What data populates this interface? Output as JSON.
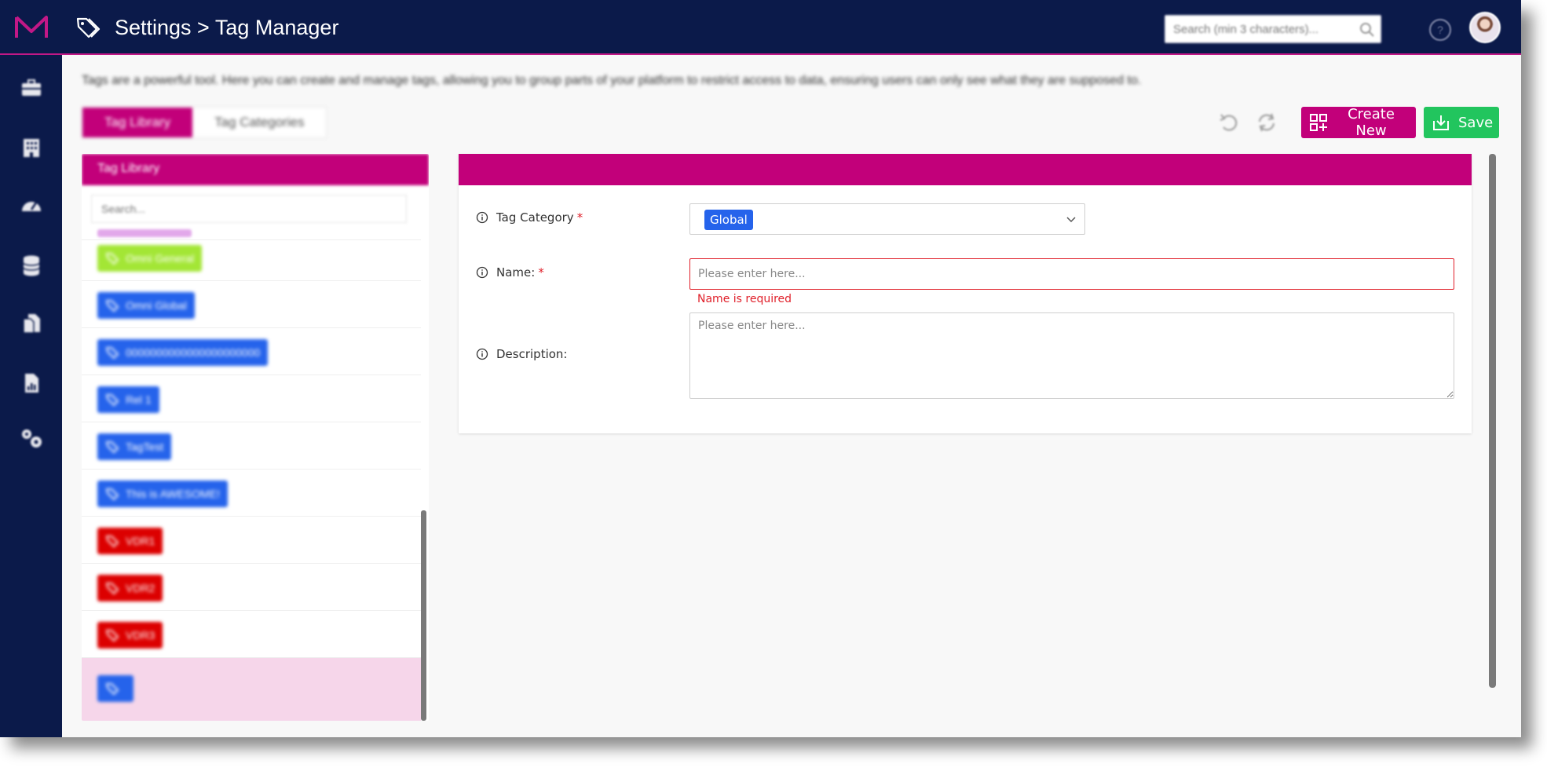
{
  "header": {
    "title": "Settings > Tag Manager",
    "search_placeholder": "Search (min 3 characters)..."
  },
  "sidebar": {
    "items": [
      {
        "icon": "briefcase-icon"
      },
      {
        "icon": "building-icon"
      },
      {
        "icon": "dashboard-gauge-icon"
      },
      {
        "icon": "database-icon"
      },
      {
        "icon": "documents-icon"
      },
      {
        "icon": "report-icon"
      },
      {
        "icon": "settings-gears-icon"
      }
    ]
  },
  "intro_text": "Tags are a powerful tool. Here you can create and manage tags, allowing you to group parts of your platform to restrict access to data, ensuring users can only see what they are supposed to.",
  "tabs": [
    {
      "label": "Tag Library",
      "active": true
    },
    {
      "label": "Tag Categories",
      "active": false
    }
  ],
  "toolbar": {
    "create_label": "Create New",
    "save_label": "Save"
  },
  "library": {
    "header": "Tag Library",
    "search_placeholder": "Search...",
    "tags": [
      {
        "label": "Omni General",
        "color": "#a3e635"
      },
      {
        "label": "Omni Global",
        "color": "#2563eb"
      },
      {
        "label": "0000000000000000000000",
        "color": "#2563eb"
      },
      {
        "label": "Rel 1",
        "color": "#2563eb"
      },
      {
        "label": "TagTest",
        "color": "#2563eb"
      },
      {
        "label": "This is AWESOME!",
        "color": "#2563eb"
      },
      {
        "label": "VDR1",
        "color": "#dc0000"
      },
      {
        "label": "VDR2",
        "color": "#dc0000"
      },
      {
        "label": "VDR3",
        "color": "#dc0000"
      },
      {
        "label": "",
        "color": "#2563eb"
      }
    ]
  },
  "form": {
    "category_label": "Tag Category",
    "category_value": "Global",
    "name_label": "Name:",
    "name_placeholder": "Please enter here...",
    "name_error": "Name is required",
    "description_label": "Description:",
    "description_placeholder": "Please enter here...",
    "required_mark": "*"
  },
  "colors": {
    "navy": "#0b1a4a",
    "brand_magenta": "#c2007a",
    "save_green": "#22c55e",
    "error_red": "#e0202a"
  }
}
